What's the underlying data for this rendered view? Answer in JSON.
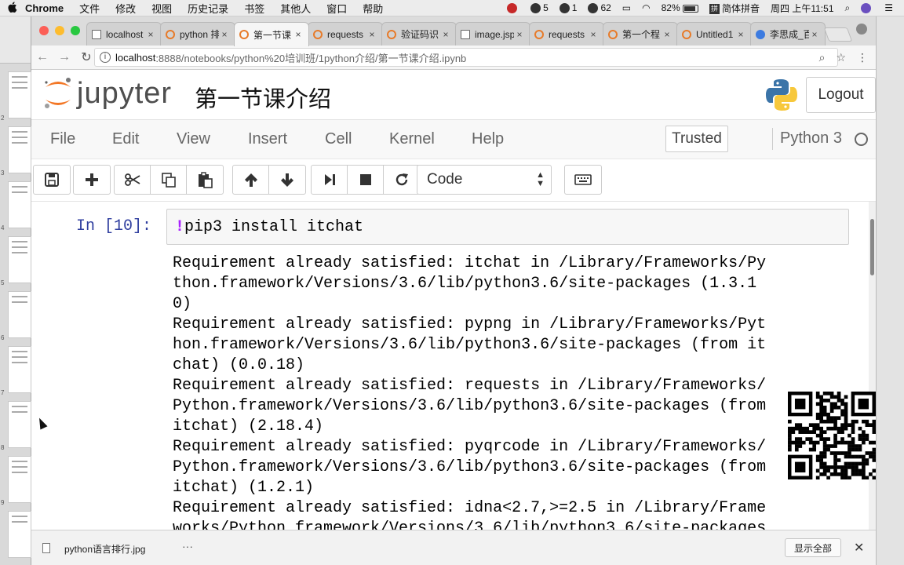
{
  "menubar": {
    "app_name": "Chrome",
    "items": [
      "文件",
      "修改",
      "视图",
      "历史记录",
      "书签",
      "其他人",
      "窗口",
      "帮助"
    ],
    "tray": {
      "badge_a": "5",
      "badge_b": "1",
      "badge_c": "62",
      "battery": "82%",
      "ime_glyph": "拼",
      "ime_label": "简体拼音",
      "clock": "周四 上午11:51"
    }
  },
  "tabs": [
    {
      "label": "localhost",
      "icon": "page-icon"
    },
    {
      "label": "python 排",
      "icon": "jupyter-icon"
    },
    {
      "label": "第一节课",
      "icon": "jupyter-icon",
      "active": true
    },
    {
      "label": "requests",
      "icon": "jupyter-icon"
    },
    {
      "label": "验证码识",
      "icon": "jupyter-icon"
    },
    {
      "label": "image.jsp",
      "icon": "page-icon"
    },
    {
      "label": "requests",
      "icon": "jupyter-icon"
    },
    {
      "label": "第一个程",
      "icon": "jupyter-icon"
    },
    {
      "label": "Untitled1",
      "icon": "jupyter-icon"
    },
    {
      "label": "李思成_百",
      "icon": "paw-icon"
    }
  ],
  "tab_close_glyph": "×",
  "address": {
    "host": "localhost",
    "path": ":8888/notebooks/python%20培训班/1python介绍/第一节课介绍.ipynb",
    "info_glyph": "i"
  },
  "jupyter": {
    "brand": "jupyter",
    "notebook_title": "第一节课介绍",
    "logout_label": "Logout",
    "menu": [
      "File",
      "Edit",
      "View",
      "Insert",
      "Cell",
      "Kernel",
      "Help"
    ],
    "trusted_label": "Trusted",
    "kernel_name": "Python 3",
    "cell_type": "Code"
  },
  "cell": {
    "prompt": "In [10]:",
    "bang": "!",
    "code": "pip3 install itchat",
    "output": "Requirement already satisfied: itchat in /Library/Frameworks/Py\nthon.framework/Versions/3.6/lib/python3.6/site-packages (1.3.1\n0)\nRequirement already satisfied: pypng in /Library/Frameworks/Pyt\nhon.framework/Versions/3.6/lib/python3.6/site-packages (from it\nchat) (0.0.18)\nRequirement already satisfied: requests in /Library/Frameworks/\nPython.framework/Versions/3.6/lib/python3.6/site-packages (from\nitchat) (2.18.4)\nRequirement already satisfied: pyqrcode in /Library/Frameworks/\nPython.framework/Versions/3.6/lib/python3.6/site-packages (from\nitchat) (1.2.1)\nRequirement already satisfied: idna<2.7,>=2.5 in /Library/Frame\nworks/Python.framework/Versions/3.6/lib/python3.6/site-packages"
  },
  "download": {
    "filename": "python语言排行.jpg",
    "more": "···",
    "show_all": "显示全部",
    "close": "✕"
  },
  "leftstrip": {
    "page_numbers": [
      "2",
      "3",
      "4",
      "5",
      "6",
      "7",
      "8",
      "9"
    ]
  }
}
